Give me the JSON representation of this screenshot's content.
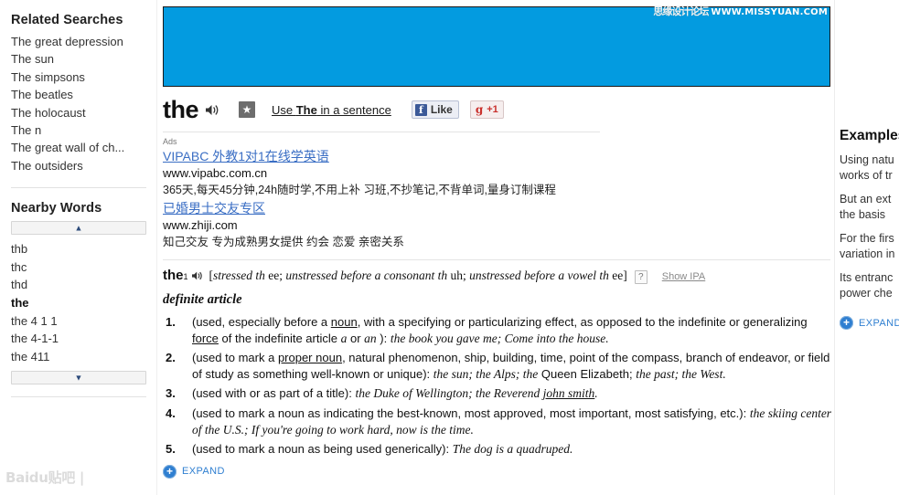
{
  "banner": {
    "color": "#039BE0",
    "watermark_cn": "思缘设计论坛",
    "watermark_url": "WWW.MISSYUAN.COM"
  },
  "sidebar": {
    "related_searches": {
      "heading": "Related Searches",
      "items": [
        "The great depression",
        "The sun",
        "The simpsons",
        "The beatles",
        "The holocaust",
        "The n",
        "The great wall of ch...",
        "The outsiders"
      ]
    },
    "nearby_words": {
      "heading": "Nearby Words",
      "scroll_up": "▲",
      "scroll_down": "▼",
      "items": [
        "thb",
        "thc",
        "thd",
        "the",
        "the 4 1 1",
        "the 4-1-1",
        "the 411"
      ],
      "current": "the"
    },
    "baidu_watermark": "Baidu贴吧 |"
  },
  "word_header": {
    "headword": "the",
    "speaker_icon": "speaker-icon",
    "star_icon": "★",
    "use_in_sentence_prefix": "Use ",
    "use_in_sentence_bold": "The",
    "use_in_sentence_suffix": " in a sentence",
    "facebook_icon": "f",
    "facebook_label": "Like",
    "google_icon": "g",
    "google_label": "+1"
  },
  "ads": {
    "label": "Ads",
    "items": [
      {
        "title": "VIPABC 外教1对1在线学英语",
        "url": "www.vipabc.com.cn",
        "desc": "365天,每天45分钟,24h随时学,不用上补 习班,不抄笔记,不背单词,量身订制课程"
      },
      {
        "title": "已婚男士交友专区",
        "url": "www.zhiji.com",
        "desc": "知己交友 专为成熟男女提供 约会 恋爱 亲密关系"
      }
    ]
  },
  "entry": {
    "word": "the",
    "superscript": "1",
    "pron_open": "[",
    "pron_1_i": "stressed th",
    "pron_1_r": " ee; ",
    "pron_2_i": "unstressed before a consonant th",
    "pron_2_r": " uh; ",
    "pron_3_i": "unstressed before a vowel th",
    "pron_3_r": " ee]",
    "help_glyph": "?",
    "show_ipa": "Show IPA",
    "part_of_speech": "definite article",
    "definitions": [
      {
        "num": "1.",
        "a": "(used, especially before a ",
        "u1": "noun",
        "b": ", with a specifying or particularizing effect, as opposed to the indefinite or generalizing ",
        "u2": "force",
        "c": " of the indefinite article ",
        "i1": "a",
        "d": " or ",
        "i2": "an",
        "e": " ): ",
        "ex": "the book you gave me; Come into the house."
      },
      {
        "num": "2.",
        "a": "(used to mark a ",
        "u1": "proper noun",
        "b": ", natural phenomenon, ship, building, time, point of the compass, branch of endeavor, or field of study as something well-known or unique): ",
        "ex1": "the sun; the Alps; the",
        "mid": " Queen Elizabeth; ",
        "ex2": "the past; the West."
      },
      {
        "num": "3.",
        "a": "(used with or as part of a title): ",
        "ex": "the Duke of Wellington; the Reverend ",
        "exu": "john smith",
        "end": "."
      },
      {
        "num": "4.",
        "a": "(used to mark a noun as indicating the best-known, most approved, most important, most satisfying, etc.): ",
        "ex": "the skiing center of the U.S.; If you're going to work hard, now is the time."
      },
      {
        "num": "5.",
        "a": "(used to mark a noun as being used generically): ",
        "ex": "The dog is a quadruped."
      }
    ],
    "expand_glyph": "+",
    "expand_label": "EXPAND"
  },
  "right_panel": {
    "heading": "Examples",
    "paragraphs": [
      "Using natu\nworks of tr",
      "But an ext\nthe basis ",
      "For the firs\nvariation in",
      "Its entranc\npower che"
    ],
    "lines": [
      [
        "Using natu",
        "works of tr"
      ],
      [
        "But an ext",
        "the basis "
      ],
      [
        "For the firs",
        "variation in"
      ],
      [
        "Its entranc",
        "power che"
      ]
    ],
    "expand_glyph": "+",
    "expand_label": "EXPAND"
  }
}
